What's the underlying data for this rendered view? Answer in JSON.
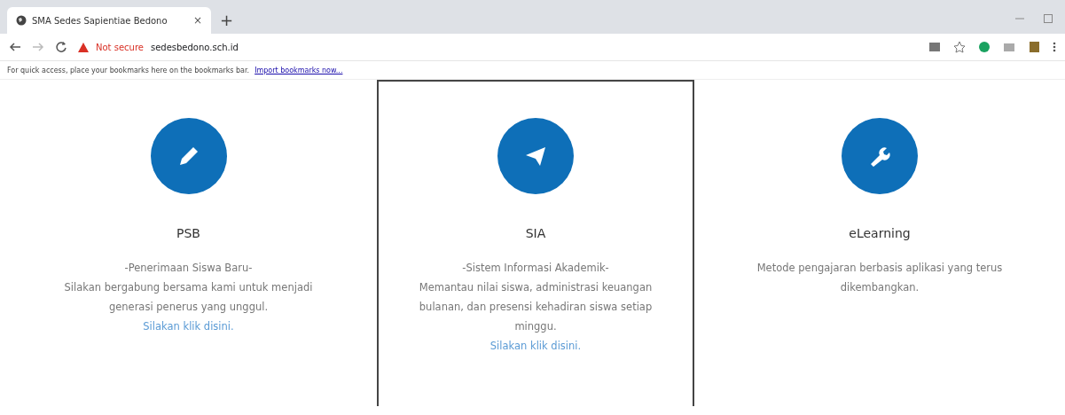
{
  "browser": {
    "tab": {
      "title": "SMA Sedes Sapientiae Bedono",
      "close": "×"
    },
    "new_tab": "+",
    "security": "Not secure",
    "url": "sedesbedono.sch.id",
    "bookmarks_bar": {
      "message": "For quick access, place your bookmarks here on the bookmarks bar.",
      "link": "Import bookmarks now..."
    }
  },
  "cards": [
    {
      "kind": "pencil",
      "title": "PSB",
      "subtitle": "-Penerimaan Siswa Baru-",
      "description": "Silakan bergabung bersama kami untuk menjadi generasi penerus yang unggul.",
      "link": "Silakan klik disini.",
      "selected": false
    },
    {
      "kind": "plane",
      "title": "SIA",
      "subtitle": "-Sistem Informasi Akademik-",
      "description": "Memantau nilai siswa, administrasi keuangan bulanan, dan presensi kehadiran siswa setiap minggu.",
      "link": "Silakan klik disini.",
      "selected": true
    },
    {
      "kind": "wrench",
      "title": "eLearning",
      "description": "Metode pengajaran berbasis aplikasi yang terus dikembangkan.",
      "selected": false
    }
  ]
}
